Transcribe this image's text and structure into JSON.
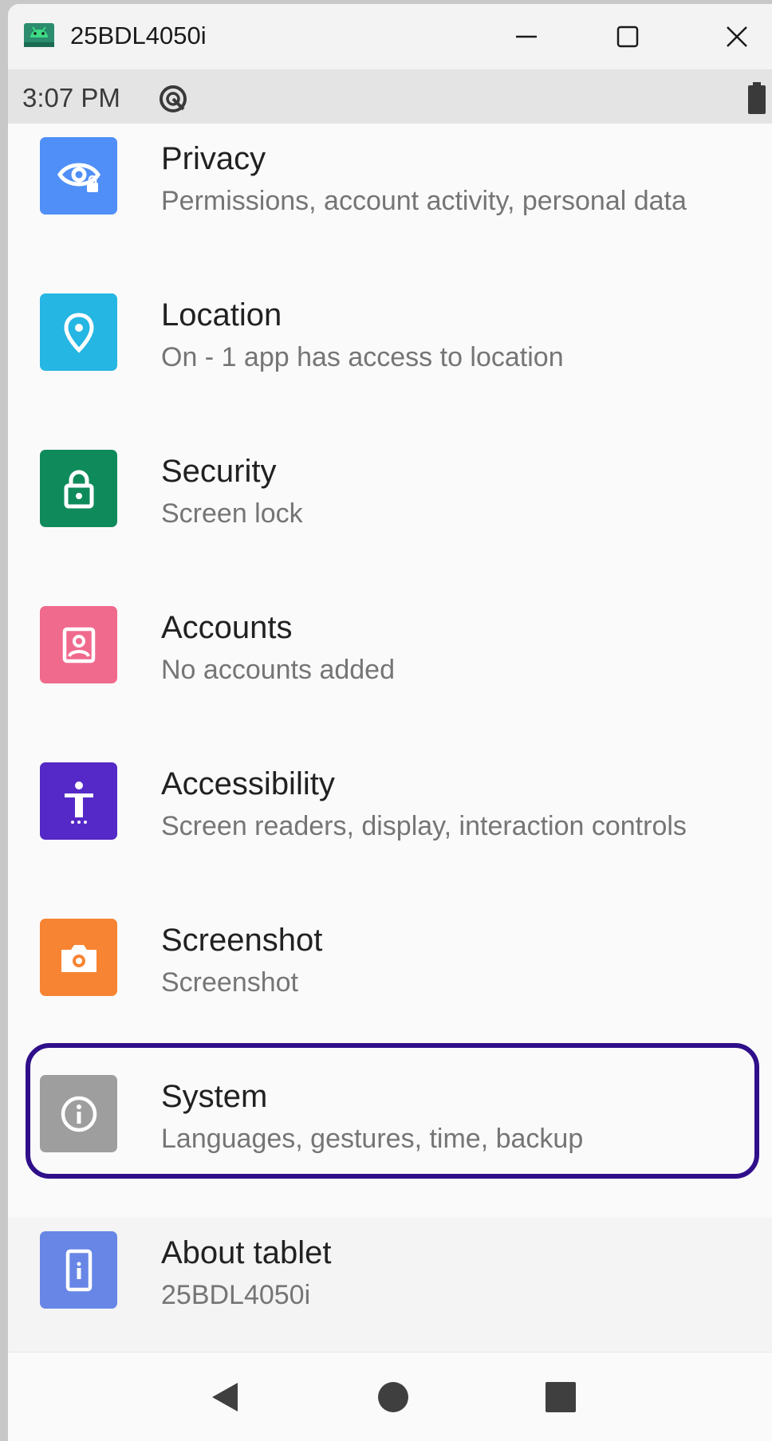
{
  "window": {
    "title": "25BDL4050i",
    "icon": "android-icon",
    "controls": [
      "minimize-icon",
      "maximize-icon",
      "close-icon"
    ]
  },
  "status_bar": {
    "time": "3:07 PM",
    "icons": [
      "sync-icon",
      "battery-icon"
    ]
  },
  "settings": [
    {
      "title": "Privacy",
      "subtitle": "Permissions, account activity, personal data",
      "icon": "privacy-eye-icon",
      "color": "#4f8ff7"
    },
    {
      "title": "Location",
      "subtitle": "On - 1 app has access to location",
      "icon": "location-pin-icon",
      "color": "#25b6e3"
    },
    {
      "title": "Security",
      "subtitle": "Screen lock",
      "icon": "lock-icon",
      "color": "#0f8a5b"
    },
    {
      "title": "Accounts",
      "subtitle": "No accounts added",
      "icon": "account-icon",
      "color": "#f06a8e"
    },
    {
      "title": "Accessibility",
      "subtitle": "Screen readers, display, interaction controls",
      "icon": "accessibility-icon",
      "color": "#5528c8"
    },
    {
      "title": "Screenshot",
      "subtitle": "Screenshot",
      "icon": "camera-icon",
      "color": "#f78432"
    },
    {
      "title": "System",
      "subtitle": "Languages, gestures, time, backup",
      "icon": "info-icon",
      "color": "#9e9e9e"
    },
    {
      "title": "About tablet",
      "subtitle": "25BDL4050i",
      "icon": "tablet-info-icon",
      "color": "#6786e6"
    }
  ],
  "highlight_color": "#2f0f8a",
  "nav_bar": [
    "back-icon",
    "home-icon",
    "recents-icon"
  ]
}
